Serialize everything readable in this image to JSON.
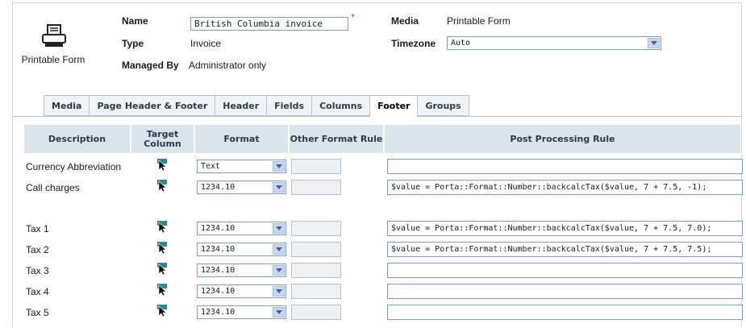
{
  "header": {
    "icon_label": "Printable Form",
    "name_label": "Name",
    "name_value": "British Columbia invoice",
    "required_mark": "*",
    "type_label": "Type",
    "type_value": "Invoice",
    "managed_label": "Managed By",
    "managed_value": "Administrator only",
    "media_label": "Media",
    "media_value": "Printable Form",
    "timezone_label": "Timezone",
    "timezone_value": "Auto"
  },
  "tabs": [
    {
      "label": "Media"
    },
    {
      "label": "Page Header & Footer"
    },
    {
      "label": "Header"
    },
    {
      "label": "Fields"
    },
    {
      "label": "Columns"
    },
    {
      "label": "Footer",
      "active": true
    },
    {
      "label": "Groups"
    }
  ],
  "table": {
    "columns": [
      "Description",
      "Target Column",
      "Format",
      "Other Format Rule",
      "Post Processing Rule"
    ],
    "rows": [
      {
        "description": "Currency Abbreviation",
        "format": "Text",
        "other": "",
        "post": ""
      },
      {
        "description": "Call charges",
        "format": "1234.10",
        "other": "",
        "post": "$value = Porta::Format::Number::backcalcTax($value, 7 + 7.5, -1);"
      },
      {
        "description": "Tax 1",
        "format": "1234.10",
        "other": "",
        "post": "$value = Porta::Format::Number::backcalcTax($value, 7 + 7.5, 7.0);"
      },
      {
        "description": "Tax 2",
        "format": "1234.10",
        "other": "",
        "post": "$value = Porta::Format::Number::backcalcTax($value, 7 + 7.5, 7.5);"
      },
      {
        "description": "Tax 3",
        "format": "1234.10",
        "other": "",
        "post": ""
      },
      {
        "description": "Tax 4",
        "format": "1234.10",
        "other": "",
        "post": ""
      },
      {
        "description": "Tax 5",
        "format": "1234.10",
        "other": "",
        "post": ""
      }
    ]
  },
  "icons": {
    "printer": "printer-icon",
    "target": "target-cursor-icon",
    "dropdown": "chevron-down-icon"
  },
  "colors": {
    "header_bg": "#d9e4ec",
    "tab_bg": "#f1f4f6",
    "input_border": "#7f9db9"
  }
}
